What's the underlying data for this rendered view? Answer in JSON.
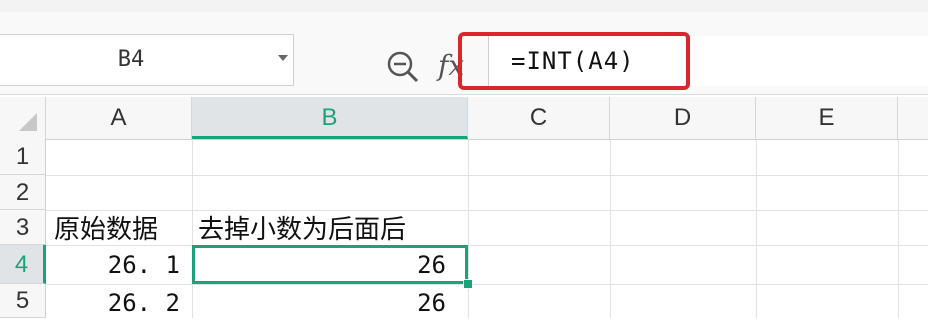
{
  "name_box": {
    "value": "B4"
  },
  "formula_bar": {
    "formula": "=INT(A4)",
    "fx_symbol": "fx"
  },
  "columns": [
    "A",
    "B",
    "C",
    "D",
    "E"
  ],
  "rows": [
    "1",
    "2",
    "3",
    "4",
    "5"
  ],
  "cells": {
    "A3": "原始数据",
    "B3": "去掉小数为后面后",
    "A4": "26. 1",
    "B4": "26",
    "A5": "26. 2",
    "B5": "26"
  },
  "selection": {
    "active_cell": "B4",
    "column": "B",
    "row": "4"
  },
  "colors": {
    "accent": "#1aa37a",
    "highlight_box": "#d9252c"
  }
}
